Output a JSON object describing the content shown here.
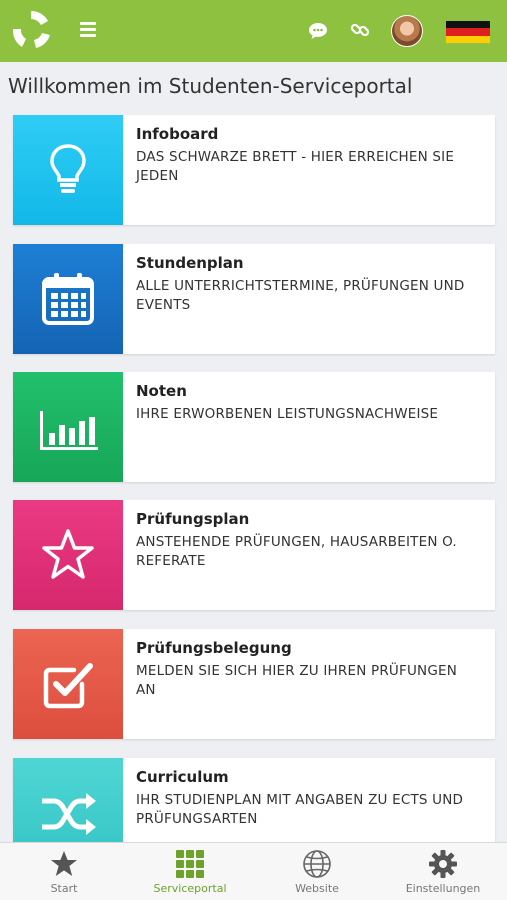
{
  "header": {
    "logo_icon": "app-logo",
    "menu_icon": "hamburger-menu-icon",
    "chat_icon": "chat-bubble-icon",
    "link_icon": "link-icon",
    "language_flag": "germany-flag",
    "colors": {
      "brand": "#8dc13f"
    }
  },
  "page": {
    "welcome": "Willkommen im Studenten-Serviceportal"
  },
  "cards": [
    {
      "title": "Infoboard",
      "description": "DAS SCHWARZE BRETT - HIER ERREICHEN SIE JEDEN",
      "icon": "lightbulb-icon",
      "color": "#1fc3f0"
    },
    {
      "title": "Stundenplan",
      "description": "ALLE UNTERRICHTSTERMINE, PRÜFUNGEN UND EVENTS",
      "icon": "calendar-icon",
      "color": "#1a73c4"
    },
    {
      "title": "Noten",
      "description": "IHRE ERWORBENEN LEISTUNGSNACHWEISE",
      "icon": "bar-chart-icon",
      "color": "#1db463"
    },
    {
      "title": "Prüfungsplan",
      "description": "ANSTEHENDE PRÜFUNGEN, HAUSARBEITEN O. REFERATE",
      "icon": "star-icon",
      "color": "#e2327a"
    },
    {
      "title": "Prüfungsbelegung",
      "description": "MELDEN SIE SICH HIER ZU IHREN PRÜFUNGEN AN",
      "icon": "checkbox-icon",
      "color": "#e55a4a"
    },
    {
      "title": "Curriculum",
      "description": "IHR STUDIENPLAN MIT ANGABEN ZU ECTS UND PRÜFUNGSARTEN",
      "icon": "shuffle-icon",
      "color": "#3fcfcf"
    }
  ],
  "tabbar": {
    "tabs": [
      {
        "label": "Start",
        "icon": "star-icon"
      },
      {
        "label": "Serviceportal",
        "icon": "grid-icon",
        "active": true
      },
      {
        "label": "Website",
        "icon": "globe-icon"
      },
      {
        "label": "Einstellungen",
        "icon": "gear-icon"
      }
    ],
    "active_color": "#6ea22c"
  }
}
